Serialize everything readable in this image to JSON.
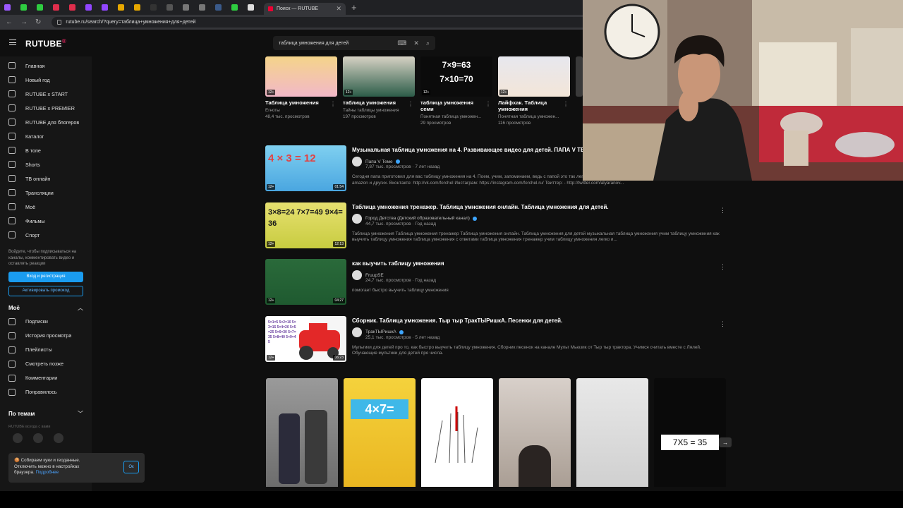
{
  "browser": {
    "tab_title": "Поиск — RUTUBE",
    "new_tab_glyph": "+",
    "close_glyph": "✕",
    "url": "rutube.ru/search/?query=таблица+умножения+для+детей",
    "tab_favicon_colors": [
      "#9b59ff",
      "#2ecc40",
      "#2ecc40",
      "#e02e4c",
      "#e02e4c",
      "#9146ff",
      "#9146ff",
      "#e6a700",
      "#e6a700",
      "#333333",
      "#555555",
      "#777777",
      "#777777",
      "#3a5a8a",
      "#2ecc40",
      "#dddddd"
    ]
  },
  "header": {
    "logo": "RUTUBE",
    "logo_sup": "®",
    "search_value": "таблица умножения для детей",
    "accent": "#1a9cf0"
  },
  "sidebar": {
    "items": [
      {
        "label": "Главная",
        "icon": "home-icon"
      },
      {
        "label": "Новый год",
        "icon": "tree-icon"
      },
      {
        "label": "RUTUBE x START",
        "icon": "start-icon"
      },
      {
        "label": "RUTUBE x PREMIER",
        "icon": "premier-icon"
      },
      {
        "label": "RUTUBE для блогеров",
        "icon": "blogger-icon"
      },
      {
        "label": "Каталог",
        "icon": "catalog-icon"
      },
      {
        "label": "В топе",
        "icon": "rocket-icon"
      },
      {
        "label": "Shorts",
        "icon": "shorts-icon"
      },
      {
        "label": "ТВ онлайн",
        "icon": "tv-icon"
      },
      {
        "label": "Трансляции",
        "icon": "broadcast-icon"
      },
      {
        "label": "Моё",
        "icon": "mine-icon"
      },
      {
        "label": "Фильмы",
        "icon": "film-icon"
      },
      {
        "label": "Спорт",
        "icon": "sport-icon"
      }
    ],
    "note": "Войдите, чтобы подписываться на каналы, комментировать видео и оставлять реакции",
    "login_button": "Вход и регистрация",
    "promo_button": "Активировать промокод",
    "mine_title": "Моё",
    "mine_items": [
      {
        "label": "Подписки",
        "icon": "subscriptions-icon"
      },
      {
        "label": "История просмотра",
        "icon": "history-icon"
      },
      {
        "label": "Плейлисты",
        "icon": "playlist-icon"
      },
      {
        "label": "Смотреть позже",
        "icon": "clock-icon"
      },
      {
        "label": "Комментарии",
        "icon": "comment-icon"
      },
      {
        "label": "Понравилось",
        "icon": "like-icon"
      }
    ],
    "topics_title": "По темам",
    "rutube_always": "RUTUBE всегда с вами",
    "footer_brands": [
      "Rutbbe",
      "Rubation",
      "Gallery Shorts"
    ]
  },
  "cookie": {
    "text": "Собираем куки и геоданные. Отключить можно в настройках браузера.",
    "link": "Подробнее",
    "ok": "Ок"
  },
  "top_cards": [
    {
      "title": "Таблица умножения",
      "channel": "Егноты",
      "views": "48,4 тыс. просмотров",
      "badge": "12+"
    },
    {
      "title": "таблица умножения",
      "channel": "Тайны таблицы умножения",
      "views": "197 просмотров",
      "badge": "12+"
    },
    {
      "title": "таблица умножения семи",
      "channel": "Понятная таблица умножен...",
      "views": "29 просмотров",
      "badge": "12+",
      "thumb_text": [
        "7×9=63",
        "7×10=70"
      ]
    },
    {
      "title": "Лайфхак. Таблица умножения",
      "channel": "Понятная таблица умножен...",
      "views": "116 просмотров",
      "badge": "12+"
    }
  ],
  "videos": [
    {
      "title": "Музыкальная таблица умножения на 4. Развивающее видео для детей. ПАПА V ТЕМЕ",
      "channel": "Папа V Теме",
      "meta": "7,87 тыс. просмотров  ·  7 лет назад",
      "desc": "Сегодня папа приготовил для вас таблицу умножения на 4. Поем, учим, запоминаем, ведь с папой это так легко! http://forchel.ru ищите нас на iTunes, spotify, yandex music, amazon и других. Вконтакте: http://vk.com/forchel Инстаграм: https://instagram.com/forchel.ru/ Твиттер: - http://twitter.com/alyaranov...",
      "duration": "01:54",
      "badge": "12+",
      "thumb_text": "4 × 3 = 12",
      "verified": true
    },
    {
      "title": "Таблица умножения тренажер. Таблица умножения онлайн. Таблица умножения для детей.",
      "channel": "Город Детства (Детский образовательный канал)",
      "meta": "44,7 тыс. просмотров  ·  Год назад",
      "desc": "Таблица умножения Таблица умножения тренажер Таблица умножения онлайн. Таблица умножения для детей музыкальная таблица умножения учим таблицу умножения как выучить таблицу умножения таблица умножения с ответами таблица умножения тренажер учим таблицу умножения легко и...",
      "duration": "12:13",
      "badge": "12+",
      "thumb_text": "3×8=24  7×7=49  9×4=36",
      "verified": true
    },
    {
      "title": "как выучить таблицу умножения",
      "channel": "FruupSE",
      "meta": "24,7 тыс. просмотров  ·  Год назад",
      "desc": "помогает быстро выучить таблицу умножения",
      "duration": "04:27",
      "badge": "12+",
      "thumb_text": "",
      "verified": false
    },
    {
      "title": "Сборник. Таблица умножения. Тыр тыр ТракТЫРишкА. Песенки для детей.",
      "channel": "ТракТЫРишкА",
      "meta": "25,1 тыс. просмотров  ·  5 лет назад",
      "desc": "Мультики для детей про то, как быстро выучить таблицу умножения. Сборник песенок на канале Мульт Мьюзик от Тыр тыр трактора. Учимся считать вместе с Лялей. Обучающие мультики для детей про числа.",
      "duration": "06:23",
      "badge": "12+",
      "thumb_text": "5×1=5 5×2=10 5×3=15 5×4=20 5×5=25 5×6=30 5×7=35 5×8=40 5×9=45",
      "verified": true
    }
  ],
  "shorts": [
    {
      "caption": ""
    },
    {
      "caption": "4×7="
    },
    {
      "caption": ""
    },
    {
      "caption": ""
    },
    {
      "caption": ""
    },
    {
      "caption": "7X5 = 35"
    }
  ]
}
